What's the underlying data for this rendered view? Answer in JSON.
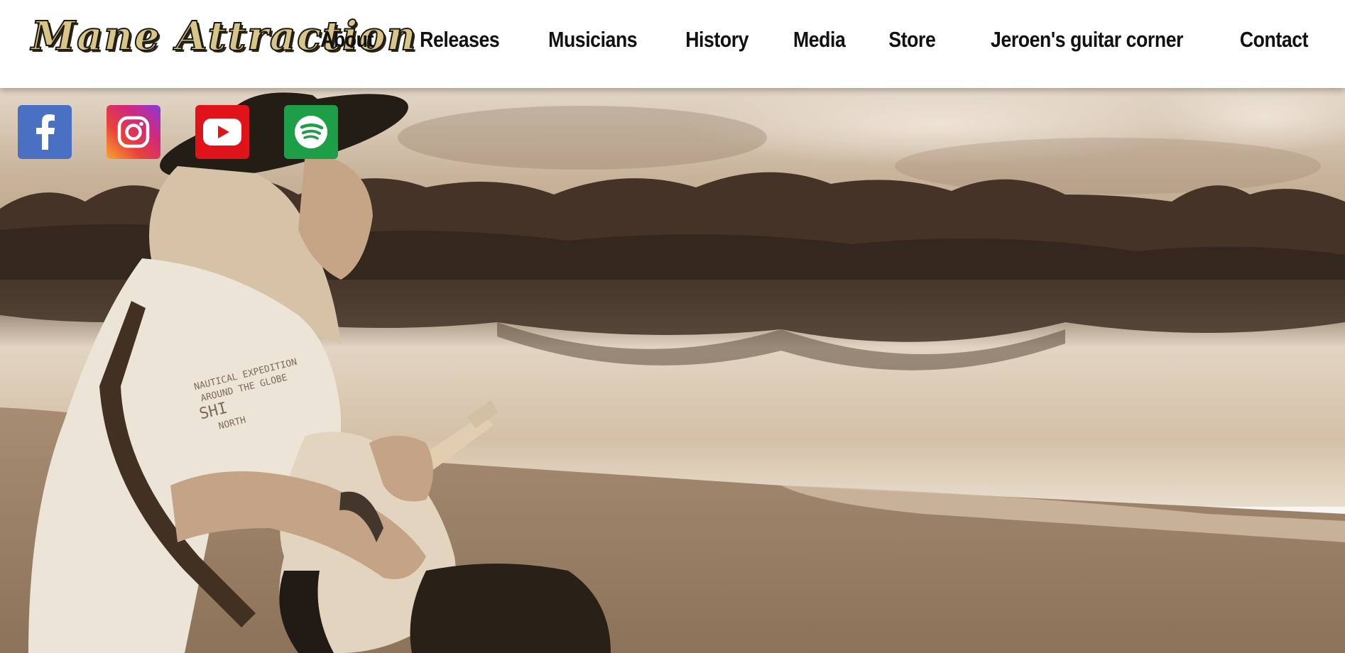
{
  "site": {
    "logo_text": "Mane Attraction"
  },
  "nav": {
    "items": [
      {
        "label": "About"
      },
      {
        "label": "Releases"
      },
      {
        "label": "Musicians"
      },
      {
        "label": "History"
      },
      {
        "label": "Media"
      },
      {
        "label": "Store"
      },
      {
        "label": "Jeroen's guitar corner"
      },
      {
        "label": "Contact"
      }
    ]
  },
  "social": [
    {
      "icon": "facebook-icon",
      "color": "#4a70c4"
    },
    {
      "icon": "instagram-icon",
      "color": "#dd2a7b"
    },
    {
      "icon": "youtube-icon",
      "color": "#e0131a"
    },
    {
      "icon": "spotify-icon",
      "color": "#1e9e46"
    }
  ],
  "hero": {
    "shirt_text_1": "NAUTICAL EXPEDITION",
    "shirt_text_2": "AROUND THE GLOBE",
    "shirt_text_3": "SHI",
    "shirt_text_4": "NORTH",
    "tone": "#c9b49a"
  }
}
